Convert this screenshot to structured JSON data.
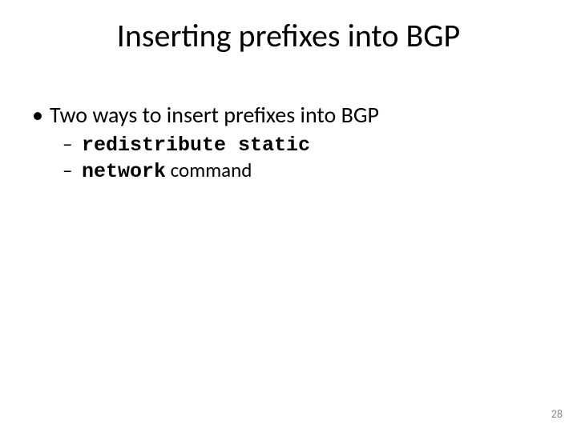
{
  "title": "Inserting prefixes into BGP",
  "bullets": {
    "main": "Two ways to insert prefixes into BGP",
    "sub1_code": "redistribute static",
    "sub2_code": "network",
    "sub2_rest": " command"
  },
  "page_number": "28"
}
